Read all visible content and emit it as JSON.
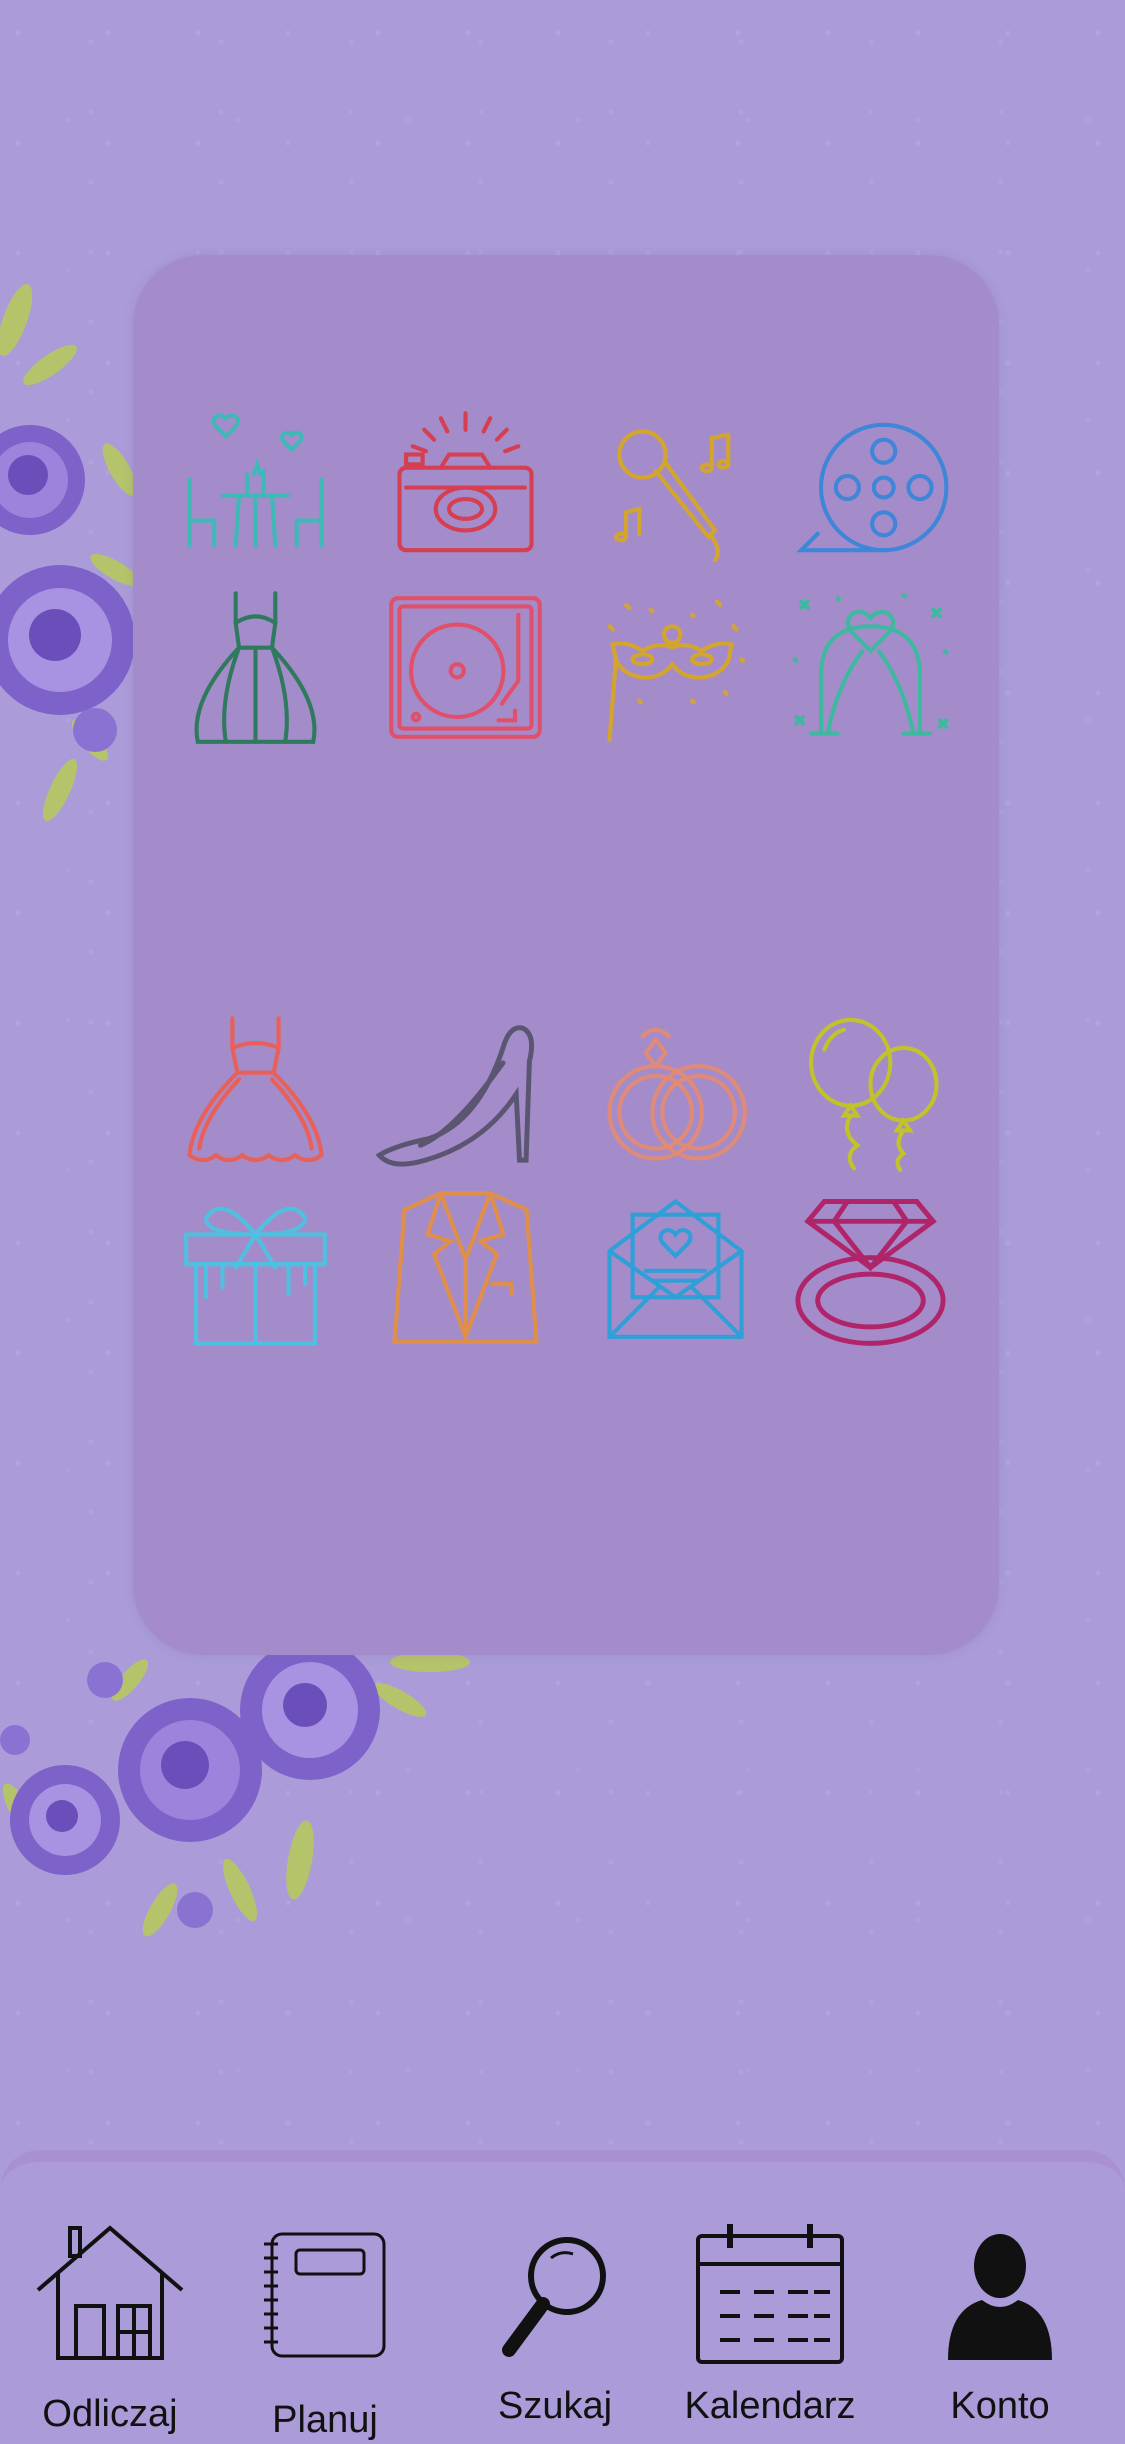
{
  "bottom_nav": {
    "items": [
      {
        "label": "Odliczaj",
        "icon": "home-icon"
      },
      {
        "label": "Planuj",
        "icon": "notebook-icon"
      },
      {
        "label": "Szukaj",
        "icon": "search-icon"
      },
      {
        "label": "Kalendarz",
        "icon": "calendar-icon"
      },
      {
        "label": "Konto",
        "icon": "account-icon"
      }
    ]
  },
  "category_icons": [
    {
      "icon": "dinner-table-icon",
      "color": "#3fb8b8"
    },
    {
      "icon": "camera-icon",
      "color": "#d63f52"
    },
    {
      "icon": "microphone-icon",
      "color": "#d4a52c"
    },
    {
      "icon": "film-reel-icon",
      "color": "#3f86d8"
    },
    {
      "icon": "wedding-dress-icon",
      "color": "#2f7a5f"
    },
    {
      "icon": "turntable-icon",
      "color": "#e0506a"
    },
    {
      "icon": "party-mask-icon",
      "color": "#d4a52c"
    },
    {
      "icon": "wedding-arch-icon",
      "color": "#3fb8a0"
    },
    {
      "icon": "dress-icon",
      "color": "#e8605a"
    },
    {
      "icon": "high-heel-icon",
      "color": "#5a5570"
    },
    {
      "icon": "wedding-rings-icon",
      "color": "#e08a78"
    },
    {
      "icon": "balloons-icon",
      "color": "#c2c22a"
    },
    {
      "icon": "gift-icon",
      "color": "#4fc0e0"
    },
    {
      "icon": "suit-icon",
      "color": "#e08f4a"
    },
    {
      "icon": "invitation-icon",
      "color": "#2f9fd8"
    },
    {
      "icon": "diamond-ring-icon",
      "color": "#b0256a"
    }
  ],
  "colors": {
    "background": "#ab9cd9",
    "panel": "#a48ccb",
    "nav_text": "#111111"
  }
}
